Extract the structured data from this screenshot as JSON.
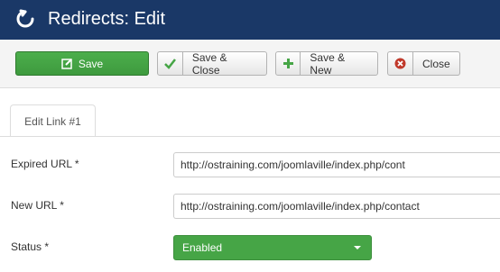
{
  "header": {
    "title": "Redirects: Edit",
    "icon": "refresh-icon"
  },
  "toolbar": {
    "save_label": "Save",
    "save_close_label": "Save & Close",
    "save_new_label": "Save & New",
    "close_label": "Close"
  },
  "tabs": [
    {
      "label": "Edit Link #1"
    }
  ],
  "form": {
    "expired_url": {
      "label": "Expired URL *",
      "value": "http://ostraining.com/joomlaville/index.php/cont"
    },
    "new_url": {
      "label": "New URL *",
      "value": "http://ostraining.com/joomlaville/index.php/contact"
    },
    "status": {
      "label": "Status *",
      "value": "Enabled"
    }
  },
  "colors": {
    "header_bg": "#1a3867",
    "save_green": "#46a546",
    "close_red": "#c0392b"
  }
}
